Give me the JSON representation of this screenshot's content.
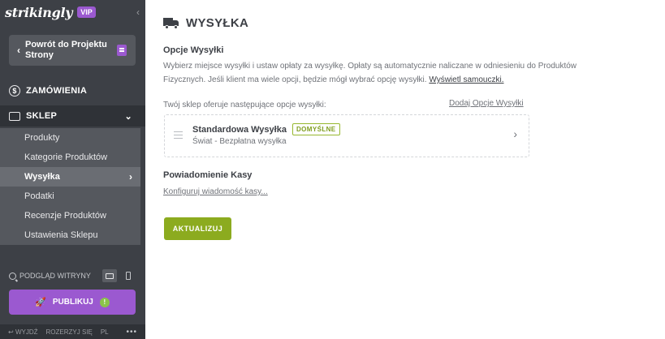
{
  "brand": {
    "logo": "strikingly",
    "badge": "VIP"
  },
  "sidebar": {
    "back_label": "Powrót do Projektu Strony",
    "orders_label": "ZAMÓWIENIA",
    "shop_label": "SKLEP",
    "items": [
      {
        "label": "Produkty"
      },
      {
        "label": "Kategorie Produktów"
      },
      {
        "label": "Wysyłka"
      },
      {
        "label": "Podatki"
      },
      {
        "label": "Recenzje Produktów"
      },
      {
        "label": "Ustawienia Sklepu"
      }
    ],
    "active_item": "Wysyłka",
    "preview_label": "PODGLĄD WITRYNY",
    "publish_label": "PUBLIKUJ",
    "footer": {
      "exit": "WYJDŹ",
      "expand": "ROZERZYJ SIĘ",
      "lang": "PL"
    }
  },
  "main": {
    "title": "WYSYŁKA",
    "options_heading": "Opcje Wysyłki",
    "description": "Wybierz miejsce wysyłki i ustaw opłaty za wysyłkę. Opłaty są automatycznie naliczane w odniesieniu do Produktów Fizycznych. Jeśli klient ma wiele opcji, będzie mógł wybrać opcję wysyłki.",
    "tutorial_link": "Wyświetl samouczki.",
    "offer_text": "Twój sklep oferuje następujące opcje wysyłki:",
    "add_option_link": "Dodaj Opcje Wysyłki",
    "option": {
      "name": "Standardowa Wysyłka",
      "badge": "DOMYŚLNE",
      "detail": "Świat - Bezpłatna wysyłka"
    },
    "notification_heading": "Powiadomienie Kasy",
    "configure_link": "Konfiguruj wiadomość kasy...",
    "update_button": "AKTUALIZUJ"
  },
  "colors": {
    "sidebar": "#3d4046",
    "accent_purple": "#9b59d0",
    "accent_green": "#8cab1f"
  },
  "icons": [
    "truck-icon",
    "dollar-icon",
    "store-icon",
    "rocket-icon",
    "desktop-icon",
    "mobile-icon",
    "search-icon",
    "drag-handle-icon"
  ]
}
